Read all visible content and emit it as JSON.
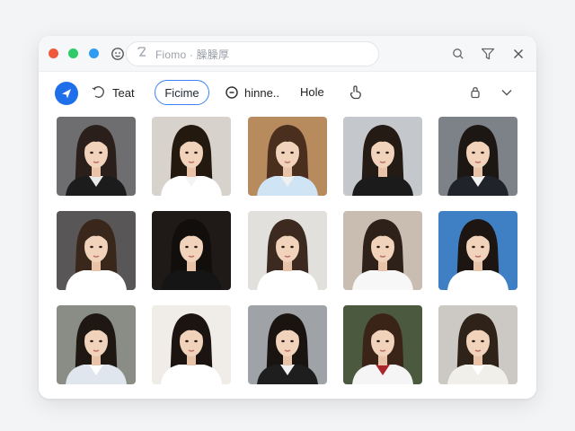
{
  "titlebar": {
    "address_text": "Fiomo · 臊臊厚"
  },
  "toolbar": {
    "items": [
      {
        "label": "Teat"
      },
      {
        "label": "Ficime"
      },
      {
        "label": "hinne.."
      },
      {
        "label": "Hole"
      }
    ]
  },
  "gallery": {
    "photos": [
      {
        "bg": "#6e6e70",
        "hair": "#2a1f1a",
        "top": "#1c1c1c",
        "collar": "#e9e9e9"
      },
      {
        "bg": "#d8d2cc",
        "hair": "#24190f",
        "top": "#ffffff",
        "collar": "#f4f4f4"
      },
      {
        "bg": "#b88b5e",
        "hair": "#4a2f1e",
        "top": "#cfe4f5",
        "collar": "#f0f0f0"
      },
      {
        "bg": "#c4c7cc",
        "hair": "#251b15",
        "top": "#1b1b1b",
        "collar": "#1b1b1b"
      },
      {
        "bg": "#7d8288",
        "hair": "#1d1713",
        "top": "#20232a",
        "collar": "#f2f2f2"
      },
      {
        "bg": "#585656",
        "hair": "#3a271b",
        "top": "#ffffff",
        "collar": "#ffffff"
      },
      {
        "bg": "#1f1a17",
        "hair": "#120e0c",
        "top": "#151515",
        "collar": "#151515"
      },
      {
        "bg": "#e2e0dc",
        "hair": "#3c2a20",
        "top": "#ffffff",
        "collar": "#ffffff"
      },
      {
        "bg": "#c9bdb2",
        "hair": "#2e2119",
        "top": "#f7f7f7",
        "collar": "#f7f7f7"
      },
      {
        "bg": "#3f7fc4",
        "hair": "#1c1511",
        "top": "#ffffff",
        "collar": "#ffffff"
      },
      {
        "bg": "#8a8d86",
        "hair": "#1e1712",
        "top": "#dfe6ee",
        "collar": "#ffffff"
      },
      {
        "bg": "#f0ede8",
        "hair": "#1b1410",
        "top": "#ffffff",
        "collar": "#ffffff"
      },
      {
        "bg": "#9fa3a8",
        "hair": "#1a1411",
        "top": "#1e1e1e",
        "collar": "#f2f2f2"
      },
      {
        "bg": "#4b5a3e",
        "hair": "#3a2417",
        "top": "#f5f5f5",
        "collar": "#a8262a"
      },
      {
        "bg": "#ccc8c3",
        "hair": "#2f2219",
        "top": "#f1efe9",
        "collar": "#ffffff"
      }
    ]
  },
  "colors": {
    "accent": "#1f6feb",
    "pill_border": "#3b82f6"
  }
}
